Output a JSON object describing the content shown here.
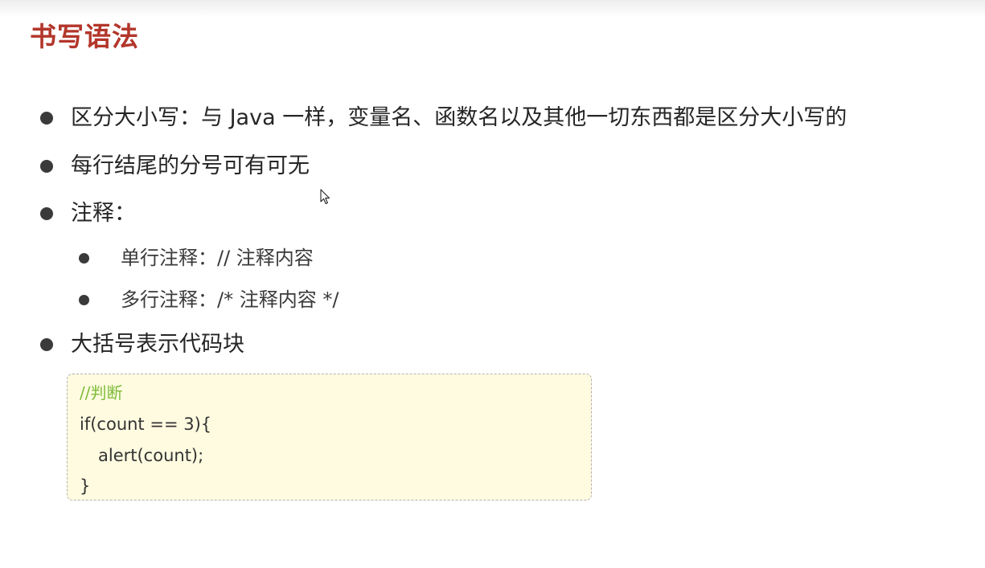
{
  "slide": {
    "title": "书写语法"
  },
  "bullets": [
    {
      "text": "区分大小写：与 Java 一样，变量名、函数名以及其他一切东西都是区分大小写的"
    },
    {
      "text": "每行结尾的分号可有可无"
    },
    {
      "text": "注释："
    },
    {
      "text": "大括号表示代码块"
    }
  ],
  "sub_bullets": [
    {
      "text": "单行注释：// 注释内容"
    },
    {
      "text": "多行注释：/* 注释内容 */"
    }
  ],
  "code": {
    "lines": [
      "//判断",
      "if(count == 3){",
      "alert(count);",
      "}"
    ]
  },
  "colors": {
    "title": "#b3362b",
    "code_background": "#fffbe0",
    "code_comment": "#7dbb3a"
  },
  "icons": {
    "cursor": "mouse-pointer-icon"
  }
}
